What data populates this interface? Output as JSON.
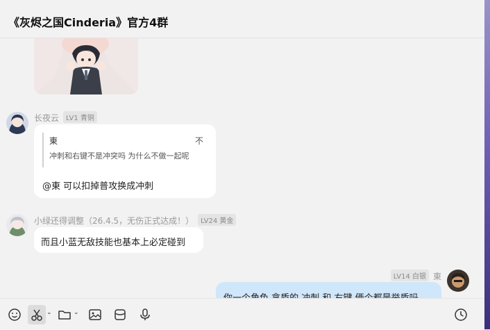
{
  "window": {
    "title": "《灰烬之国Cinderia》官方4群"
  },
  "messages": [
    {
      "sender": "长夜云",
      "level": "LV1 青铜",
      "quote": {
        "author": "東",
        "mark": "不",
        "text": "冲刺和右键不是冲突吗 为什么不做一起呢"
      },
      "text": "@東 可以扣掉普攻换成冲刺"
    },
    {
      "sender": "小绿还得调整（26.4.5，无伤正式达成！）",
      "level": "LV24 黄金",
      "text": "而且小蓝无敌技能也基本上必定碰到"
    },
    {
      "sender": "東",
      "level": "LV14 白银",
      "text": "你一个角色 拿盾的 冲刺 和 右键 俩个都是举盾吗"
    }
  ],
  "toolbar": {
    "icons": [
      "emoji-icon",
      "scissors-icon",
      "folder-icon",
      "image-icon",
      "bag-icon",
      "microphone-icon",
      "history-icon"
    ]
  },
  "colors": {
    "my_bubble": "#cfe6fb",
    "accent_edge": "#6e5fb3"
  }
}
